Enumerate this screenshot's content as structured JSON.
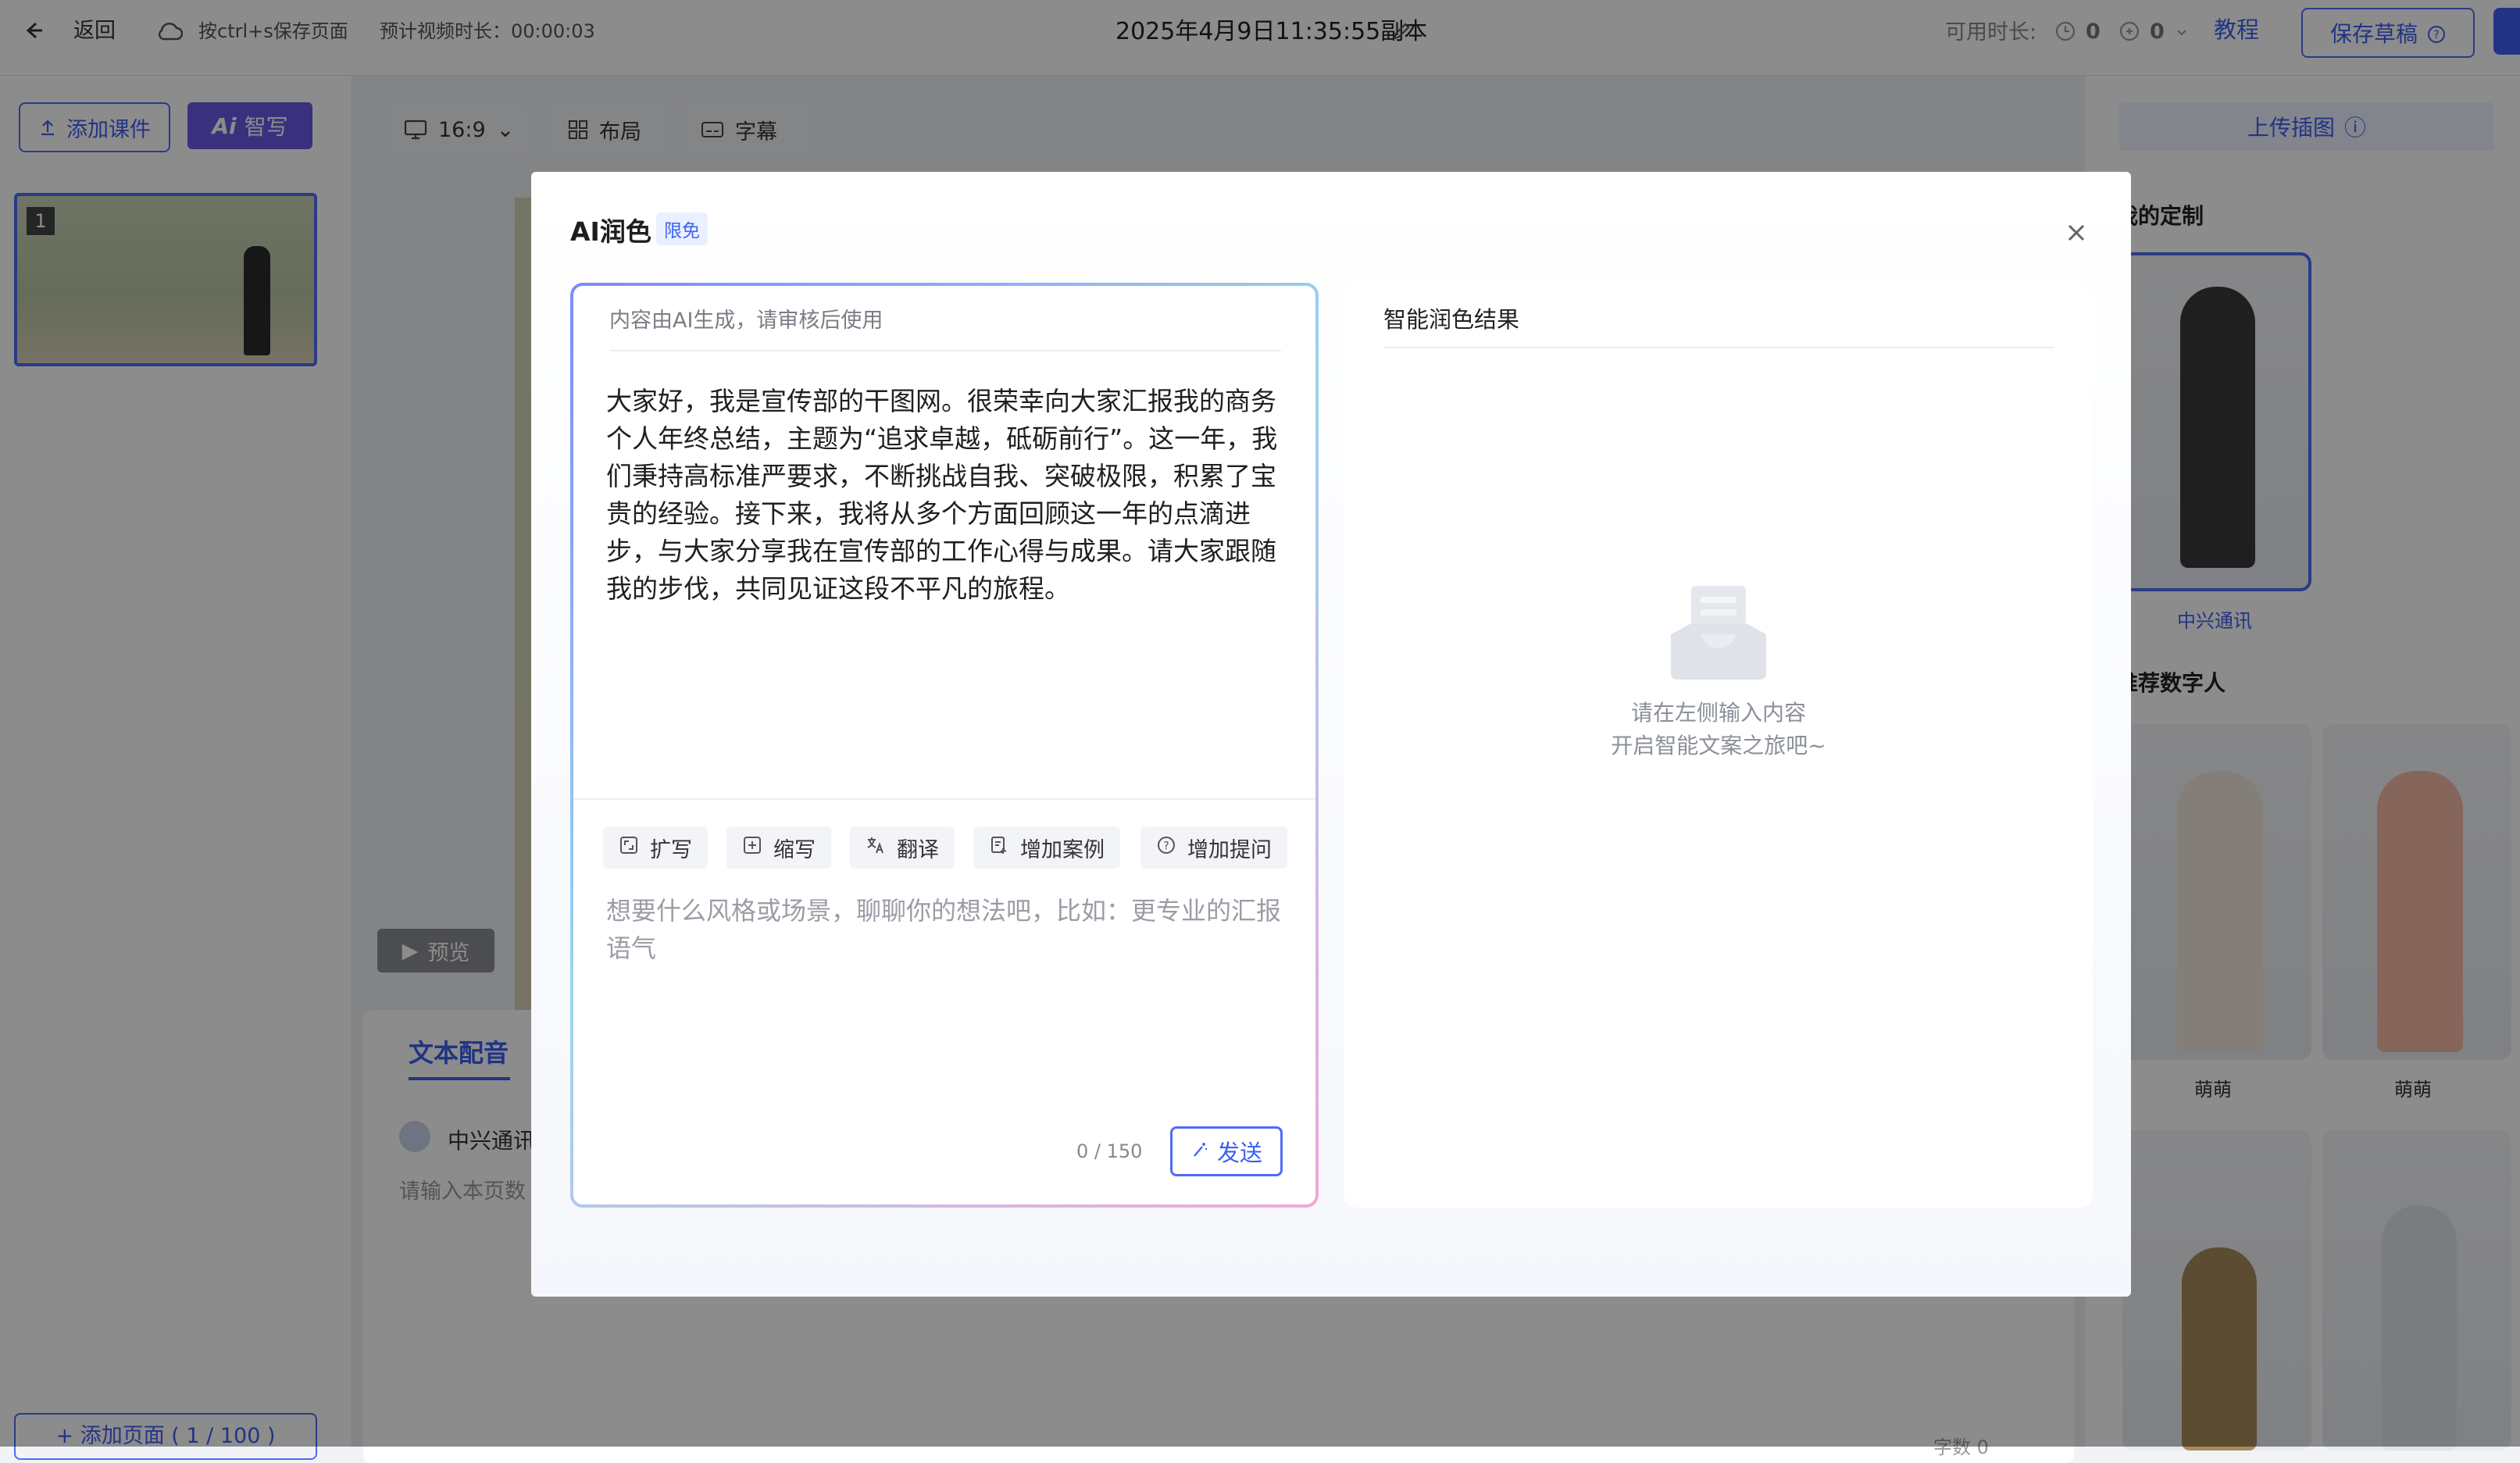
{
  "topbar": {
    "back_label": "返回",
    "save_hint": "按ctrl+s保存页面",
    "duration_label": "预计视频时长：00:00:03",
    "doc_title": "2025年4月9日11:35:55副本",
    "available_label": "可用时长:",
    "time_value_1": "0",
    "time_value_2": "0",
    "tutorial_label": "教程",
    "save_draft_label": "保存草稿"
  },
  "left": {
    "add_courseware": "添加课件",
    "ai_write": "智写",
    "slide_number": "1",
    "add_page": "+ 添加页面 ( 1 / 100 )"
  },
  "canvas_toolbar": {
    "ratio": "16:9",
    "layout": "布局",
    "subtitle": "字幕",
    "preview": "预览"
  },
  "bottom": {
    "tab_voice": "文本配音",
    "voice_name": "中兴通讯",
    "text_placeholder": "请输入本页数",
    "word_count": "字数 0"
  },
  "right": {
    "upload_label": "上传插图",
    "my_custom": "我的定制",
    "custom_name": "中兴通讯",
    "recommend": "推荐数字人",
    "avatars": [
      "萌萌",
      "萌萌"
    ]
  },
  "modal": {
    "title": "AI润色",
    "badge": "限免",
    "input_hint": "内容由AI生成，请审核后使用",
    "content": "大家好，我是宣传部的干图网。很荣幸向大家汇报我的商务个人年终总结，主题为“追求卓越，砥砺前行”。这一年，我们秉持高标准严要求，不断挑战自我、突破极限，积累了宝贵的经验。接下来，我将从多个方面回顾这一年的点滴进步，与大家分享我在宣传部的工作心得与成果。请大家跟随我的步伐，共同见证这段不平凡的旅程。",
    "tools": [
      {
        "label": "扩写",
        "icon": "expand-icon"
      },
      {
        "label": "缩写",
        "icon": "shrink-icon"
      },
      {
        "label": "翻译",
        "icon": "translate-icon"
      },
      {
        "label": "增加案例",
        "icon": "add-case-icon"
      },
      {
        "label": "增加提问",
        "icon": "question-icon"
      }
    ],
    "prompt_placeholder": "想要什么风格或场景，聊聊你的想法吧，比如：更专业的汇报语气",
    "counter": "0 / 150",
    "send_label": "发送",
    "result_title": "智能润色结果",
    "empty_line1": "请在左侧输入内容",
    "empty_line2": "开启智能文案之旅吧~"
  },
  "colors": {
    "accent": "#3c5ff0",
    "ai_button": "#6a5ae6",
    "overlay": "rgba(0,0,0,0.45)"
  }
}
